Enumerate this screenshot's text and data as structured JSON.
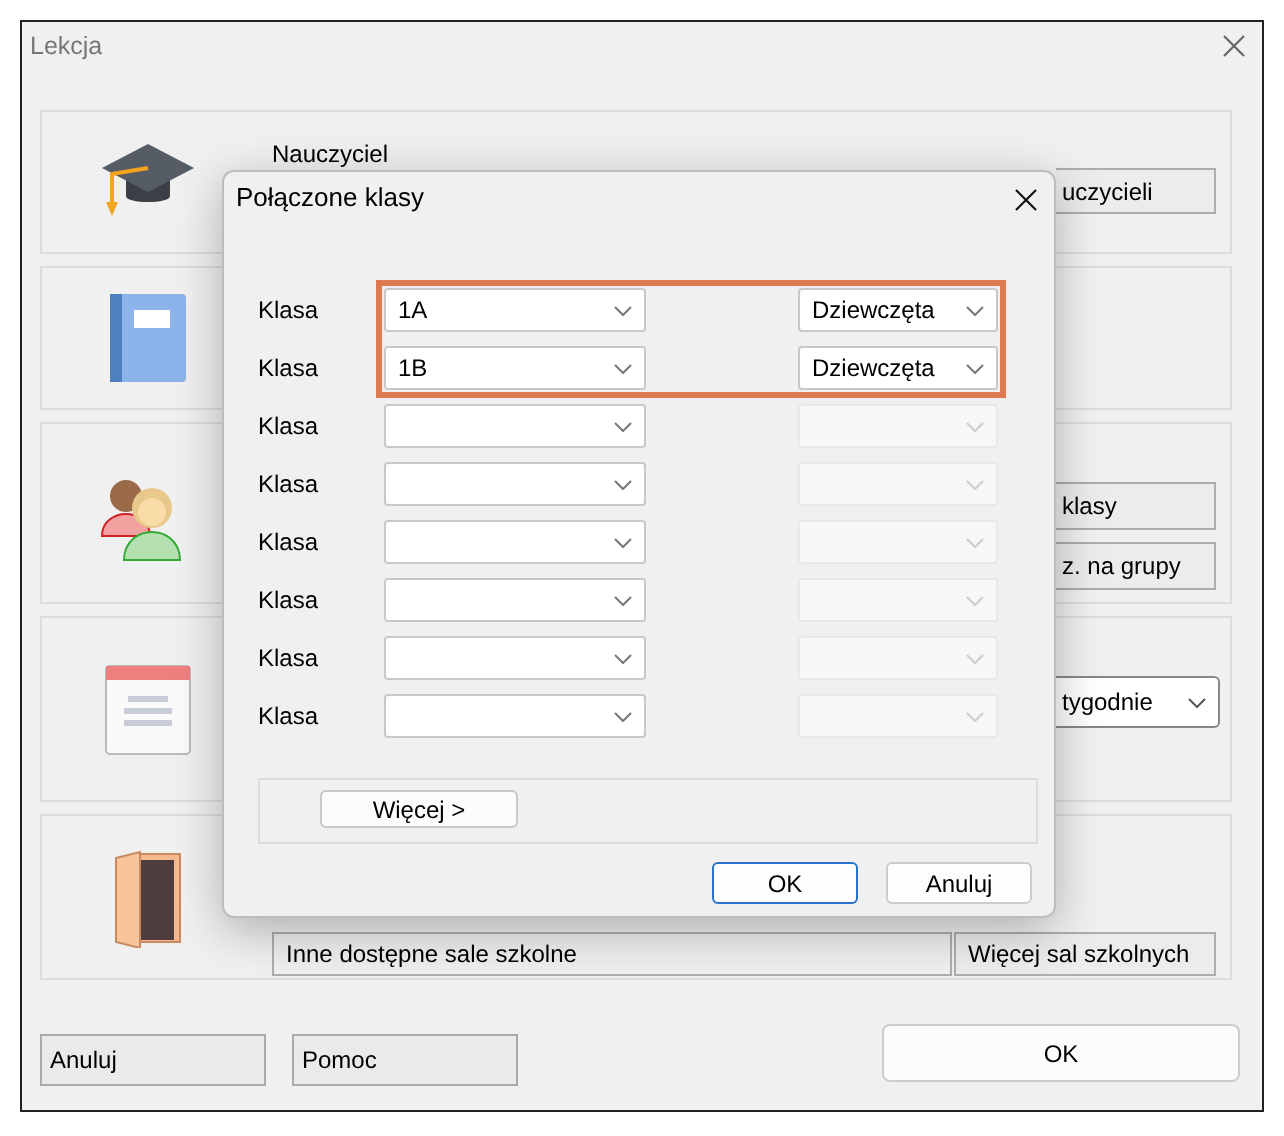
{
  "window": {
    "title": "Lekcja"
  },
  "sections": [
    {
      "kind": "teacher",
      "label": "Nauczyciel",
      "buttons": [
        "uczycieli"
      ]
    },
    {
      "kind": "subject"
    },
    {
      "kind": "classes",
      "buttons": [
        "klasy",
        "z. na grupy"
      ]
    },
    {
      "kind": "schedule",
      "dropdown": "tygodnie"
    },
    {
      "kind": "room",
      "field": "Inne dostępne sale szkolne",
      "buttons": [
        "Więcej sal szkolnych"
      ]
    }
  ],
  "footer": {
    "left_buttons": [
      "Anuluj",
      "Pomoc"
    ],
    "ok": "OK"
  },
  "dialog": {
    "title": "Połączone klasy",
    "rows": [
      {
        "label": "Klasa",
        "class": "1A",
        "group": "Dziewczęta",
        "group_disabled": false,
        "highlighted": true
      },
      {
        "label": "Klasa",
        "class": "1B",
        "group": "Dziewczęta",
        "group_disabled": false,
        "highlighted": true
      },
      {
        "label": "Klasa",
        "group_disabled": true,
        "highlighted": false
      },
      {
        "label": "Klasa",
        "group_disabled": true,
        "highlighted": false
      },
      {
        "label": "Klasa",
        "group_disabled": true,
        "highlighted": false
      },
      {
        "label": "Klasa",
        "group_disabled": true,
        "highlighted": false
      },
      {
        "label": "Klasa",
        "group_disabled": true,
        "highlighted": false
      },
      {
        "label": "Klasa",
        "group_disabled": true,
        "highlighted": false
      }
    ],
    "more_button": "Więcej >",
    "buttons": [
      {
        "label": "OK",
        "default": true
      },
      {
        "label": "Anuluj",
        "default": false
      }
    ]
  }
}
